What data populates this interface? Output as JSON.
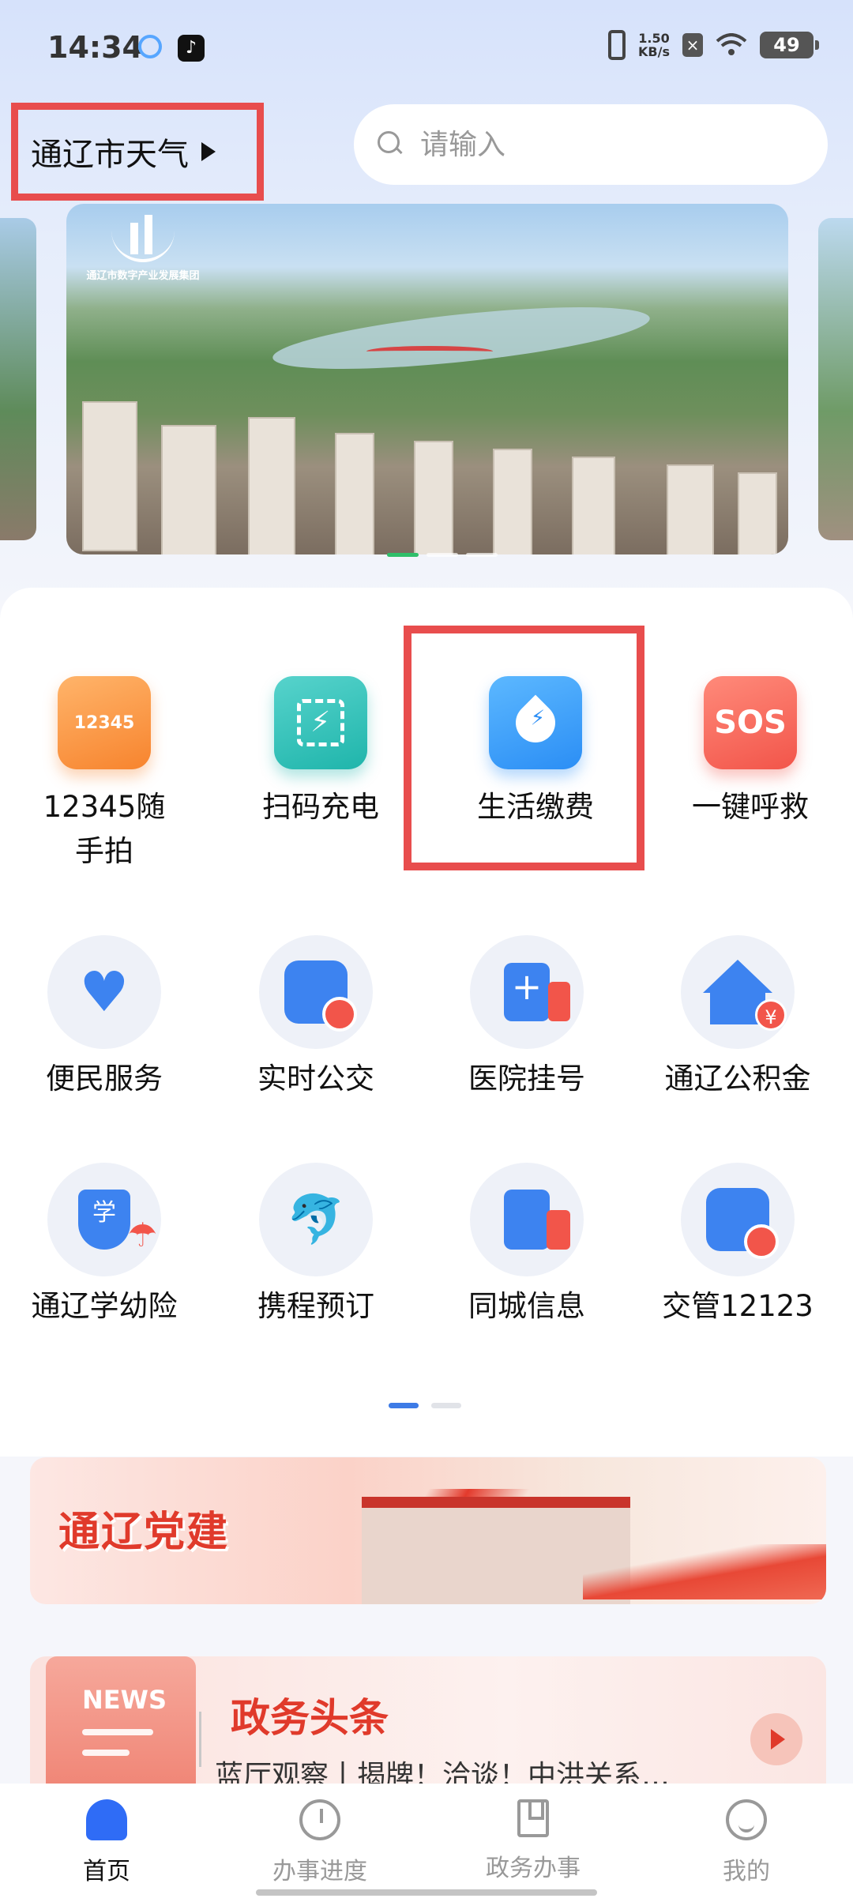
{
  "status_bar": {
    "time": "14:34",
    "net_speed_value": "1.50",
    "net_speed_unit": "KB/s",
    "battery": "49"
  },
  "header": {
    "weather_label": "通辽市天气",
    "search_placeholder": "请输入"
  },
  "banner": {
    "logo_text": "通辽市数字产业发展集团"
  },
  "services_row1": [
    {
      "label": "12345随手拍",
      "icon": "12345-camera-icon",
      "icon_text": "12345"
    },
    {
      "label": "扫码充电",
      "icon": "scan-charge-icon"
    },
    {
      "label": "生活缴费",
      "icon": "water-drop-icon"
    },
    {
      "label": "一键呼救",
      "icon": "sos-icon",
      "icon_text": "SOS"
    }
  ],
  "services_row2": [
    {
      "label": "便民服务",
      "icon": "heart-hands-icon"
    },
    {
      "label": "实时公交",
      "icon": "bus-clock-icon"
    },
    {
      "label": "医院挂号",
      "icon": "hospital-icon"
    },
    {
      "label": "通辽公积金",
      "icon": "house-fund-icon",
      "icon_text": "¥"
    }
  ],
  "services_row3": [
    {
      "label": "通辽学幼险",
      "icon": "school-insurance-icon",
      "icon_text": "学"
    },
    {
      "label": "携程预订",
      "icon": "dolphin-icon"
    },
    {
      "label": "同城信息",
      "icon": "city-info-icon"
    },
    {
      "label": "交管12123",
      "icon": "traffic-bus-icon"
    }
  ],
  "party_banner": {
    "title": "通辽党建"
  },
  "news": {
    "badge": "NEWS",
    "title": "政务头条",
    "headline": "蓝厅观察丨揭牌！洽谈！中洪关系…"
  },
  "bottom_nav": [
    {
      "label": "首页",
      "icon": "home-icon",
      "active": true
    },
    {
      "label": "办事进度",
      "icon": "clock-icon",
      "active": false
    },
    {
      "label": "政务办事",
      "icon": "bookmark-icon",
      "active": false
    },
    {
      "label": "我的",
      "icon": "smile-icon",
      "active": false
    }
  ],
  "colors": {
    "accent": "#2f6cf6",
    "highlight": "#e84d4d"
  }
}
